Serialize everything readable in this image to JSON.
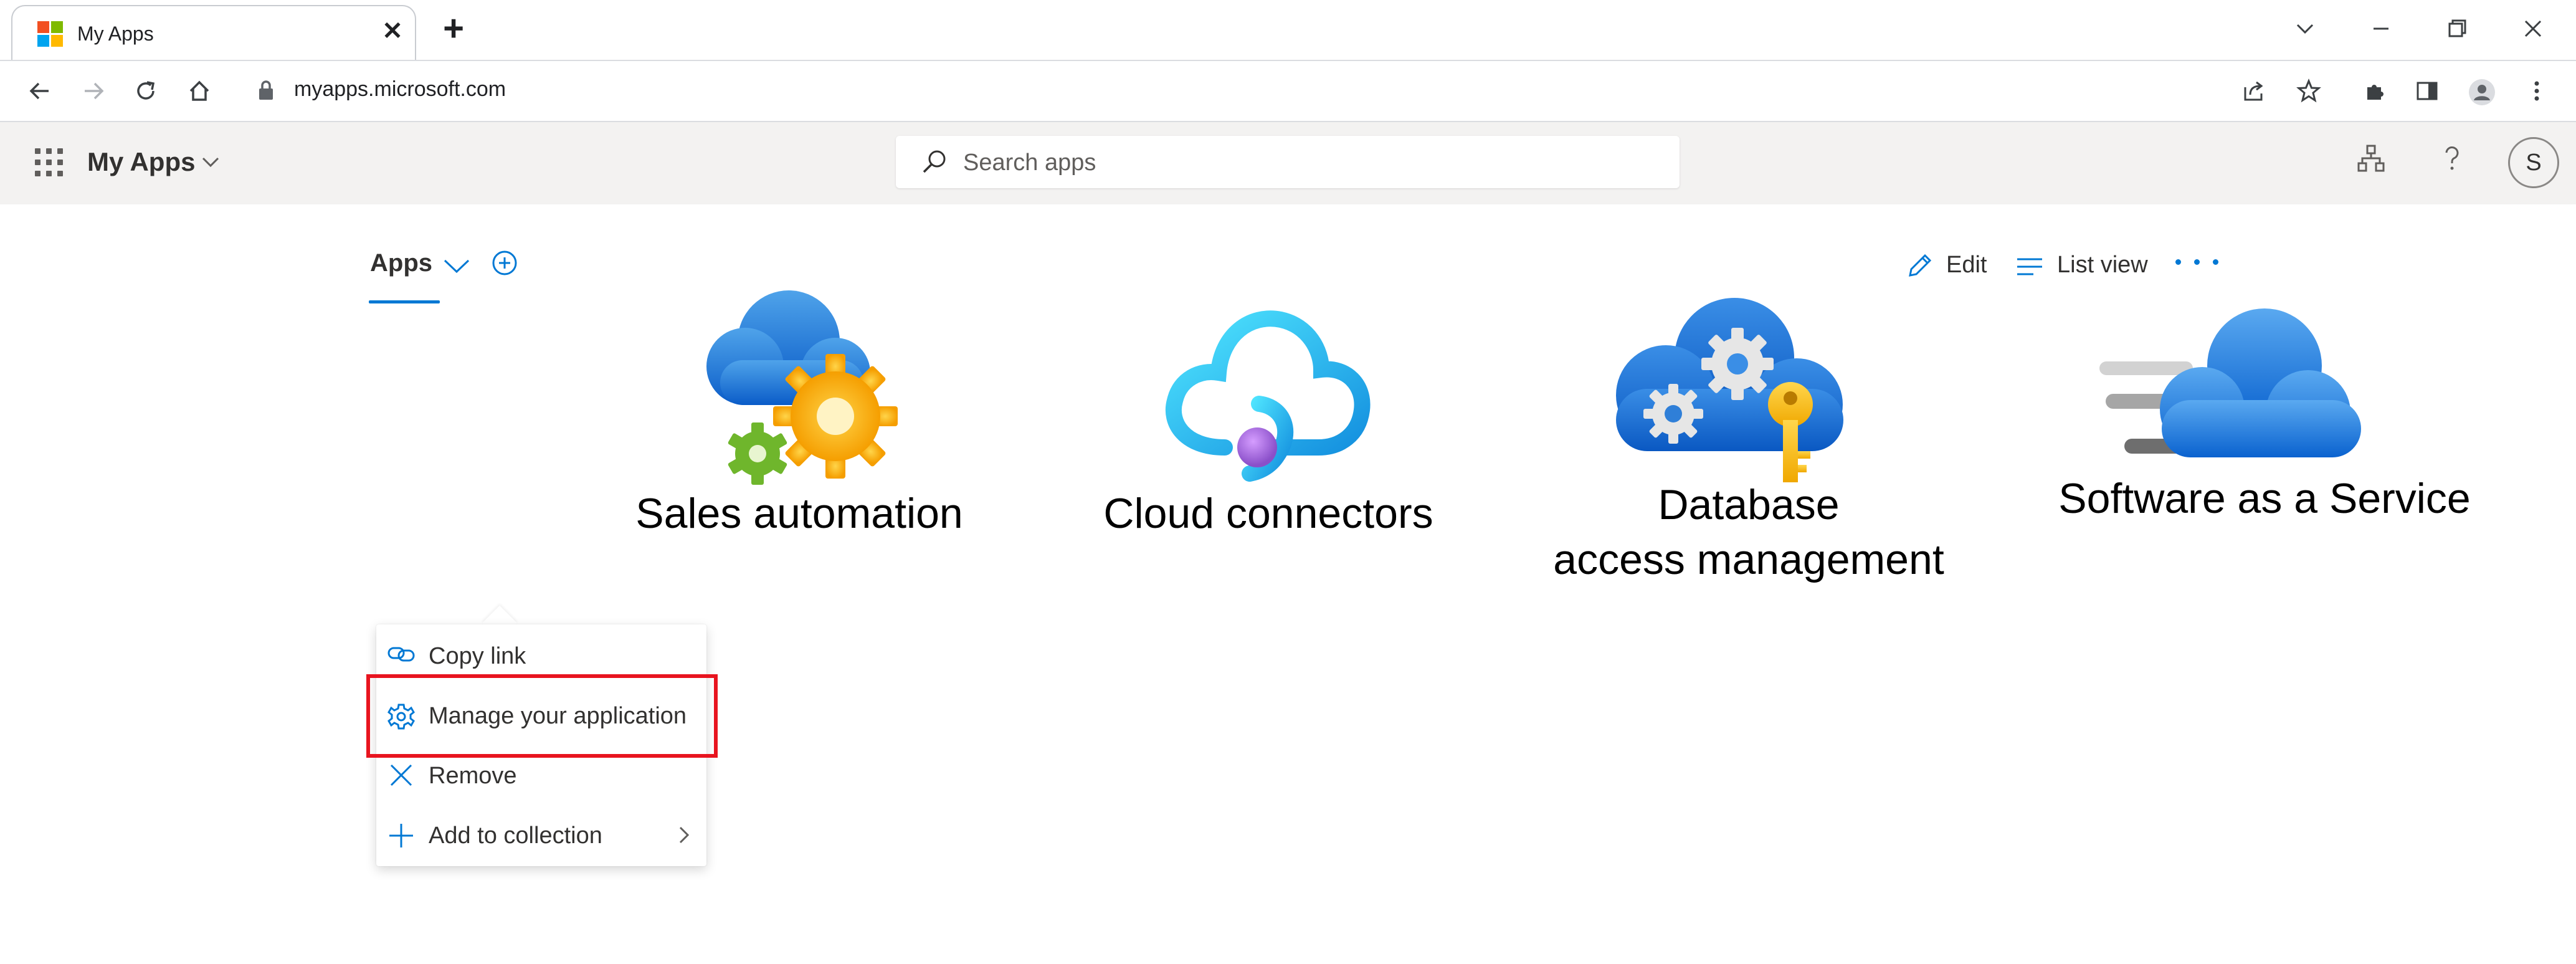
{
  "browser": {
    "tab_title": "My Apps",
    "url": "myapps.microsoft.com"
  },
  "header": {
    "app_title": "My Apps",
    "search_placeholder": "Search apps",
    "avatar_initial": "S"
  },
  "toolbar": {
    "apps_tab_label": "Apps",
    "edit_label": "Edit",
    "list_view_label": "List view"
  },
  "apps": [
    {
      "label": "Sales automation",
      "icon": "cloud-gears-icon"
    },
    {
      "label": "Cloud connectors",
      "icon": "cloud-connector-icon"
    },
    {
      "label_line1": "Database",
      "label_line2": "access management",
      "icon": "cloud-gears-key-icon"
    },
    {
      "label": "Software as a Service",
      "icon": "fast-cloud-icon"
    }
  ],
  "context_menu": {
    "items": [
      {
        "label": "Copy link",
        "icon": "link-icon"
      },
      {
        "label": "Manage your application",
        "icon": "gear-icon",
        "highlighted": true
      },
      {
        "label": "Remove",
        "icon": "close-icon"
      },
      {
        "label": "Add to collection",
        "icon": "add-icon",
        "has_submenu": true
      }
    ]
  },
  "colors": {
    "accent": "#0078d4",
    "highlight_border": "#e8141f",
    "header_bg": "#f3f2f1"
  }
}
